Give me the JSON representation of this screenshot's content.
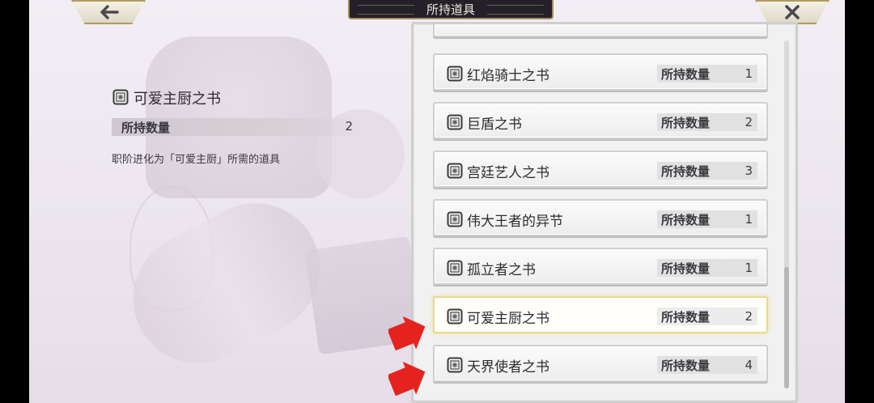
{
  "header": {
    "title": "所持道具"
  },
  "detail": {
    "icon": "book-icon",
    "name": "可爱主厨之书",
    "qty_label": "所持数量",
    "qty_value": "2",
    "description": "职阶进化为「可爱主厨」所需的道具"
  },
  "list": {
    "items": [
      {
        "name": "",
        "qty_label": "",
        "qty": ""
      },
      {
        "name": "红焰骑士之书",
        "qty_label": "所持数量",
        "qty": "1"
      },
      {
        "name": "巨盾之书",
        "qty_label": "所持数量",
        "qty": "2"
      },
      {
        "name": "宫廷艺人之书",
        "qty_label": "所持数量",
        "qty": "3"
      },
      {
        "name": "伟大王者的异节",
        "qty_label": "所持数量",
        "qty": "1"
      },
      {
        "name": "孤立者之书",
        "qty_label": "所持数量",
        "qty": "1"
      },
      {
        "name": "可爱主厨之书",
        "qty_label": "所持数量",
        "qty": "2",
        "selected": true
      },
      {
        "name": "天界使者之书",
        "qty_label": "所持数量",
        "qty": "4"
      }
    ]
  },
  "icons": {
    "back": "back-arrow-icon",
    "close": "close-icon",
    "item": "book-icon",
    "annotation": "red-arrow-icon"
  },
  "colors": {
    "selected_border": "#ecd78b",
    "annotation_arrow": "#e5231e",
    "title_bar_bg": "#24202a",
    "gold_trim": "#b59a5f"
  }
}
